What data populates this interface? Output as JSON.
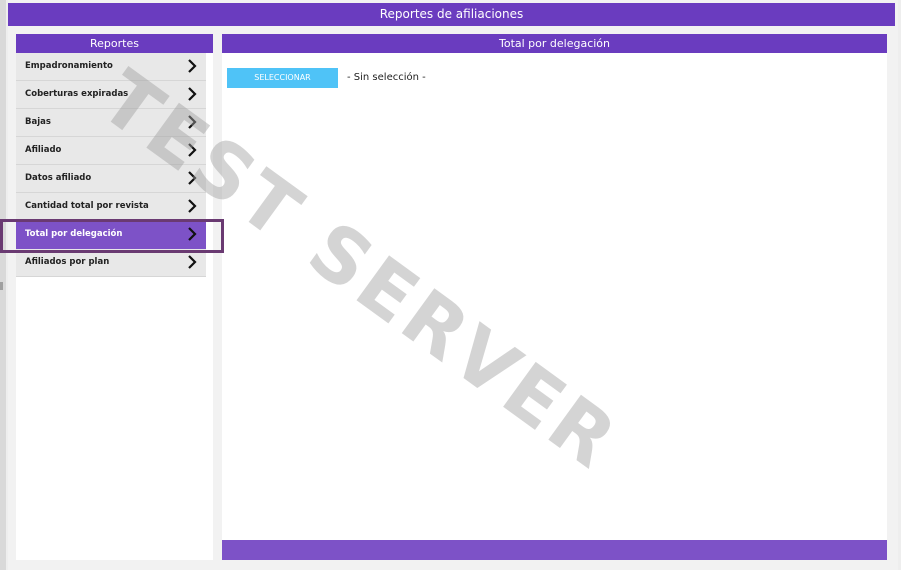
{
  "app": {
    "title": "Reportes de afiliaciones"
  },
  "sidebar": {
    "title": "Reportes",
    "items": [
      {
        "label": "Empadronamiento",
        "active": false
      },
      {
        "label": "Coberturas expiradas",
        "active": false
      },
      {
        "label": "Bajas",
        "active": false
      },
      {
        "label": "Afiliado",
        "active": false
      },
      {
        "label": "Datos afiliado",
        "active": false
      },
      {
        "label": "Cantidad total por revista",
        "active": false
      },
      {
        "label": "Total por delegación",
        "active": true
      },
      {
        "label": "Afiliados por plan",
        "active": false
      }
    ]
  },
  "main": {
    "title": "Total por delegación",
    "select_button": "SELECCIONAR",
    "selection_status": "- Sin selección -"
  },
  "watermark": "TEST SERVER",
  "colors": {
    "header": "#6a3cbf",
    "active_item": "#7d52c7",
    "select_button": "#4fc3f7"
  }
}
